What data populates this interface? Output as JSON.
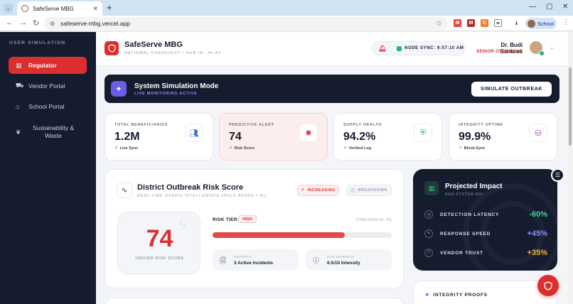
{
  "browser": {
    "tab_title": "SafeServe MBG",
    "url": "safeserve-mbg.vercel.app",
    "profile_label": "School"
  },
  "sidebar": {
    "heading": "USER SIMULATION",
    "items": [
      {
        "label": "Regulator",
        "icon": "grid-icon",
        "active": true
      },
      {
        "label": "Vendor Portal",
        "icon": "truck-icon",
        "active": false
      },
      {
        "label": "School Portal",
        "icon": "school-icon",
        "active": false
      },
      {
        "label": "Sustainability & Waste",
        "icon": "leaf-icon",
        "active": false
      }
    ]
  },
  "header": {
    "brand": "SafeServe MBG",
    "brand_sub": "NATIONAL OVERSIGHT • HUB ID: JK-A1",
    "sync": "NODE SYNC: 9:57:10 AM",
    "user_name": "Dr. Budi Santoso",
    "user_role": "SENIOR OVERSIGHT"
  },
  "simulation": {
    "title": "System Simulation Mode",
    "subtitle": "LIVE MONITORING ACTIVE",
    "button": "SIMULATE OUTBREAK"
  },
  "stats": [
    {
      "label": "TOTAL BENEFICIARIES",
      "value": "1.2M",
      "foot": "Live Sync",
      "icon": "users-icon",
      "color": "#3b6fd8"
    },
    {
      "label": "PREDICTIVE ALERT",
      "value": "74",
      "foot": "Risk Score",
      "icon": "virus-icon",
      "color": "#dc2e2e"
    },
    {
      "label": "SUPPLY HEALTH",
      "value": "94.2%",
      "foot": "Verified Log",
      "icon": "shield-check-icon",
      "color": "#22b573"
    },
    {
      "label": "INTEGRITY UPTIME",
      "value": "99.9%",
      "foot": "Block-Sync",
      "icon": "database-icon",
      "color": "#9b4dca"
    }
  ],
  "risk": {
    "title": "District Outbreak Risk Score",
    "subtitle": "REAL-TIME HYBRID INTELLIGENCE (RULE-BASED + AI)",
    "trend": "INCREASING",
    "breakdown": "BREAKDOWN",
    "score": "74",
    "score_label": "UNIFIED RISK SCORE",
    "tier_label": "RISK TIER:",
    "tier": "HIGH",
    "threshold": "THRESHOLD: 65",
    "progress": 0.74,
    "reports_label": "REPORTS",
    "reports_value": "3 Active Incidents",
    "severity_label": "AVG SEVERITY",
    "severity_value": "6.5/10 Intensity"
  },
  "impact": {
    "title": "Projected Impact",
    "subtitle": "SGN SYSTEM ROI",
    "rows": [
      {
        "label": "DETECTION LATENCY",
        "value": "-60%",
        "color": "#3fd39a",
        "icon": "clock-icon"
      },
      {
        "label": "RESPONSE SPEED",
        "value": "+45%",
        "color": "#8c8bff",
        "icon": "bolt-icon"
      },
      {
        "label": "VENDOR TRUST",
        "value": "+35%",
        "color": "#f5b731",
        "icon": "shield-icon"
      }
    ]
  },
  "integrity": {
    "title": "INTEGRITY PROOFS"
  }
}
